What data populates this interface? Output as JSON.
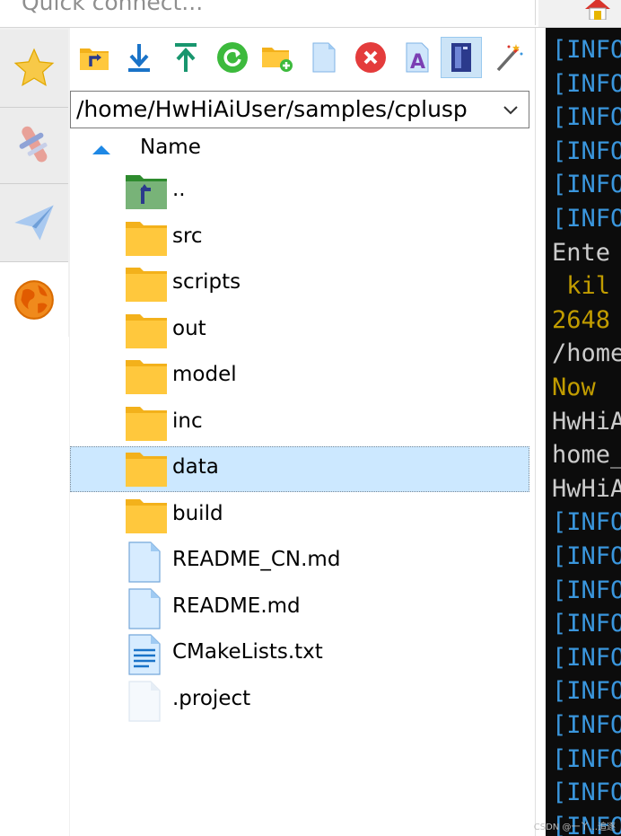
{
  "quick_connect": {
    "placeholder": "Quick connect..."
  },
  "side_tabs": [
    {
      "name": "sessions-favorites",
      "icon": "star-icon"
    },
    {
      "name": "tools",
      "icon": "swiss-knife-icon"
    },
    {
      "name": "tunneling",
      "icon": "paper-plane-icon"
    },
    {
      "name": "sftp",
      "icon": "globe-icon",
      "active": true
    }
  ],
  "toolbar": [
    {
      "name": "parent-folder",
      "icon": "folder-up-icon"
    },
    {
      "name": "download",
      "icon": "download-icon"
    },
    {
      "name": "upload",
      "icon": "upload-icon"
    },
    {
      "name": "refresh",
      "icon": "refresh-icon"
    },
    {
      "name": "new-folder",
      "icon": "new-folder-icon"
    },
    {
      "name": "new-file",
      "icon": "new-file-icon"
    },
    {
      "name": "delete",
      "icon": "delete-icon"
    },
    {
      "name": "rename",
      "icon": "rename-icon"
    },
    {
      "name": "toggle-panel",
      "icon": "panel-icon",
      "active": true
    },
    {
      "name": "magic",
      "icon": "magic-wand-icon"
    }
  ],
  "path": {
    "value": "/home/HwHiAiUser/samples/cplusp"
  },
  "columns": {
    "name": "Name"
  },
  "files": [
    {
      "name": "..",
      "type": "parent"
    },
    {
      "name": "src",
      "type": "folder"
    },
    {
      "name": "scripts",
      "type": "folder"
    },
    {
      "name": "out",
      "type": "folder"
    },
    {
      "name": "model",
      "type": "folder"
    },
    {
      "name": "inc",
      "type": "folder"
    },
    {
      "name": "data",
      "type": "folder",
      "selected": true
    },
    {
      "name": "build",
      "type": "folder"
    },
    {
      "name": "README_CN.md",
      "type": "file"
    },
    {
      "name": "README.md",
      "type": "file"
    },
    {
      "name": "CMakeLists.txt",
      "type": "text"
    },
    {
      "name": ".project",
      "type": "blank"
    }
  ],
  "terminal": {
    "lines": [
      {
        "text": "[INFO",
        "color": "#3a96dd"
      },
      {
        "text": "[INFO",
        "color": "#3a96dd"
      },
      {
        "text": "[INFO",
        "color": "#3a96dd"
      },
      {
        "text": "[INFO",
        "color": "#3a96dd"
      },
      {
        "text": "[INFO",
        "color": "#3a96dd"
      },
      {
        "text": "[INFO",
        "color": "#3a96dd"
      },
      {
        "text": "Ente",
        "color": "#cccccc"
      },
      {
        "text": " kil",
        "color": "#c19c00"
      },
      {
        "text": "2648",
        "color": "#c19c00"
      },
      {
        "text": "/home",
        "color": "#cccccc"
      },
      {
        "text": "Now ",
        "color": "#c19c00"
      },
      {
        "text": "HwHiA",
        "color": "#cccccc"
      },
      {
        "text": "home_",
        "color": "#cccccc"
      },
      {
        "text": "HwHiA",
        "color": "#cccccc"
      },
      {
        "text": "[INFO",
        "color": "#3a96dd"
      },
      {
        "text": "[INFO",
        "color": "#3a96dd"
      },
      {
        "text": "[INFO",
        "color": "#3a96dd"
      },
      {
        "text": "[INFO",
        "color": "#3a96dd"
      },
      {
        "text": "[INFO",
        "color": "#3a96dd"
      },
      {
        "text": "[INFO",
        "color": "#3a96dd"
      },
      {
        "text": "[INFO",
        "color": "#3a96dd"
      },
      {
        "text": "[INFO",
        "color": "#3a96dd"
      },
      {
        "text": "[INFO",
        "color": "#3a96dd"
      },
      {
        "text": "[INFO",
        "color": "#3a96dd"
      }
    ]
  },
  "watermark": {
    "text": "CSDN @一丫...追逐"
  },
  "colors": {
    "folder": "#ffc83d",
    "selection": "#cce8ff",
    "terminal_bg": "#0c0c0c"
  }
}
